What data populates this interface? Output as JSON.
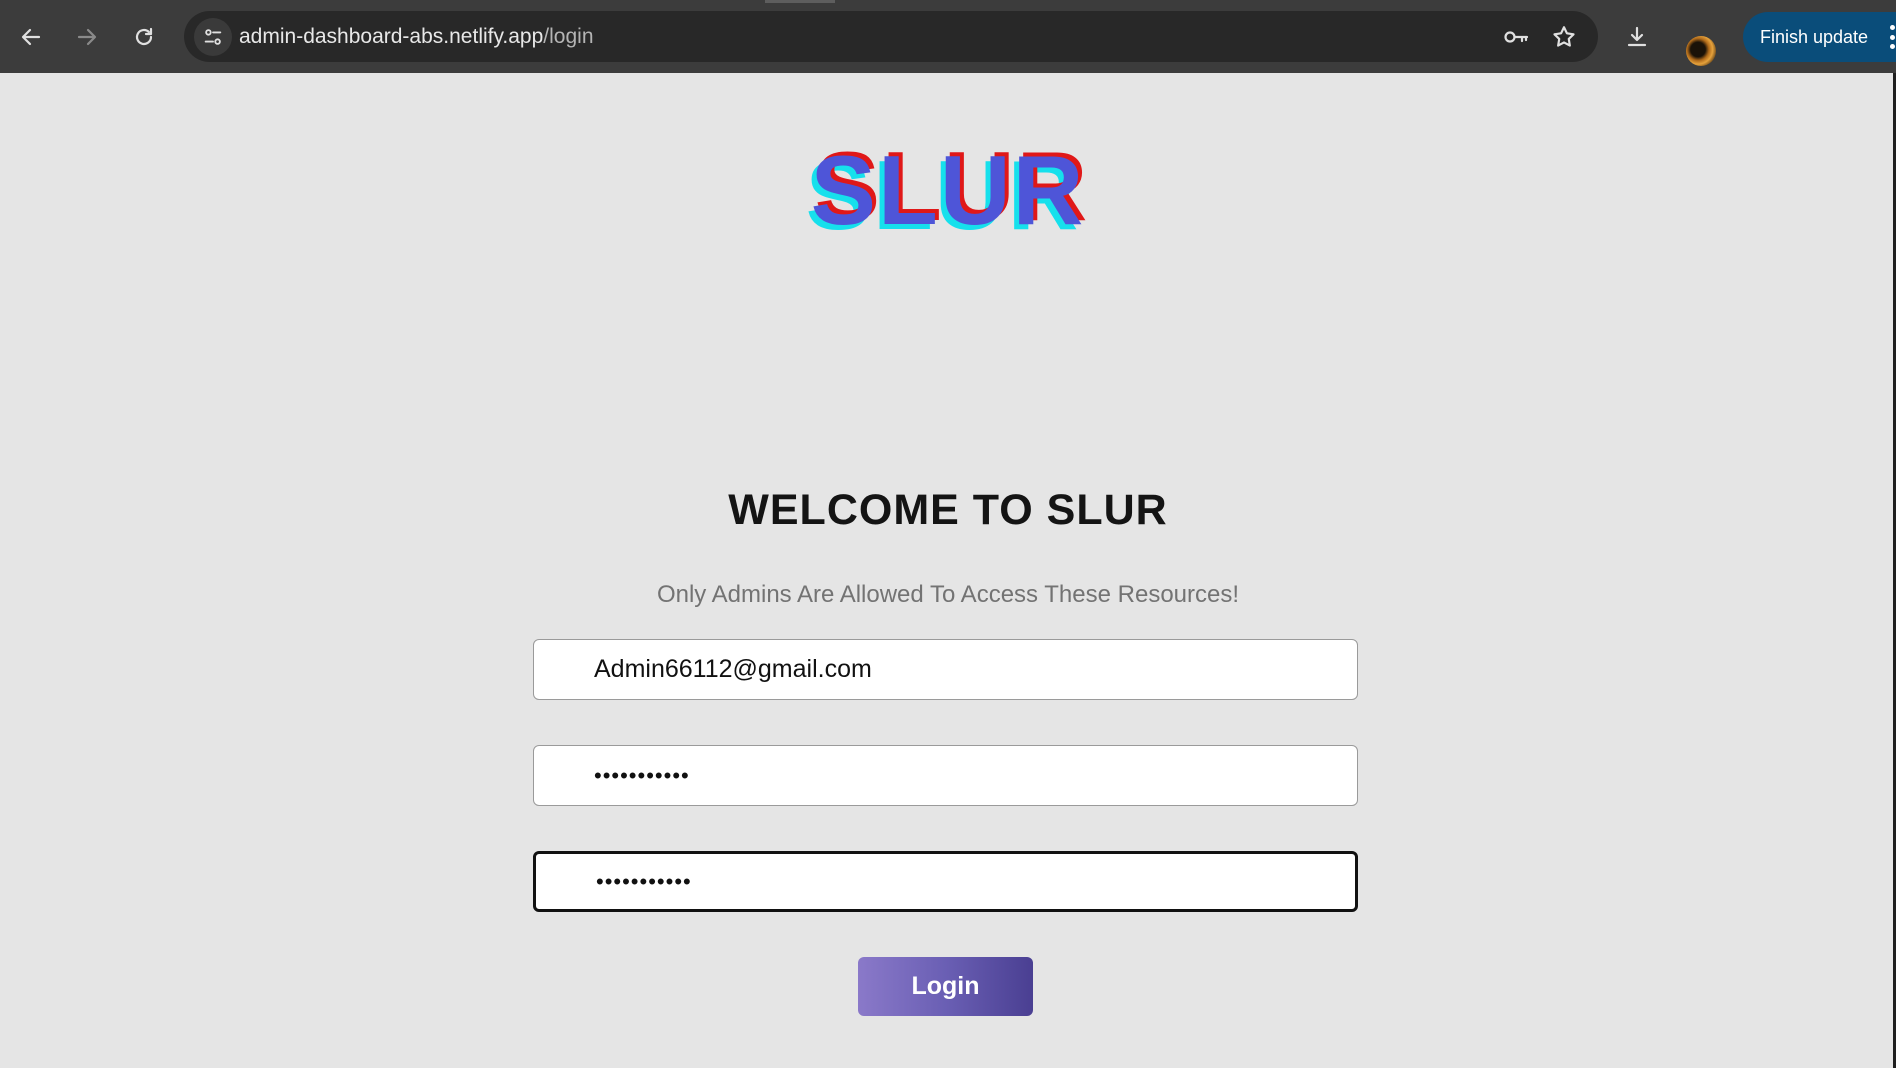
{
  "browser": {
    "url_host": "admin-dashboard-abs.netlify.app",
    "url_path": "/login",
    "finish_update_label": "Finish update",
    "icons": {
      "back": "arrow-left-icon",
      "forward": "arrow-right-icon",
      "reload": "reload-icon",
      "site_info": "tune-icon",
      "password": "key-icon",
      "bookmark": "star-icon",
      "downloads": "download-icon",
      "menu": "kebab-menu-icon"
    },
    "colors": {
      "toolbar": "#3c3c3c",
      "omnibox": "#282828",
      "update_button": "#0a4d7a"
    }
  },
  "login": {
    "logo_text": "SLUR",
    "title": "WELCOME TO SLUR",
    "subtitle": "Only Admins Are Allowed To Access These Resources!",
    "email_value": "Admin66112@gmail.com",
    "password_value": "•••••••••••",
    "confirm_password_value": "•••••••••••",
    "submit_label": "Login",
    "colors": {
      "logo_main": "#4e55d8",
      "logo_shadow_red": "#e01818",
      "logo_shadow_cyan": "#16e0ec",
      "button_start": "#8a79c9",
      "button_end": "#4a3f92",
      "background": "#e5e5e5"
    }
  }
}
